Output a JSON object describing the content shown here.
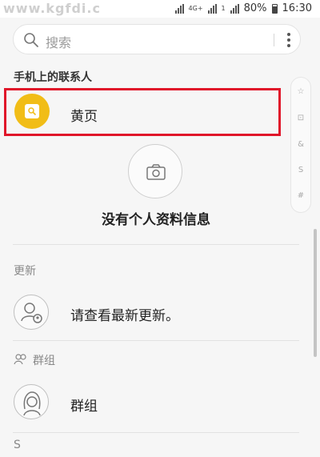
{
  "status_bar": {
    "watermark": "www.kgfdi.c",
    "battery": "80%",
    "time": "16:30",
    "signal_label_1": "4G+",
    "signal_label_2": "1"
  },
  "search": {
    "placeholder": "搜索",
    "icon": "search-icon",
    "menu_icon": "more-vert-icon"
  },
  "sections": {
    "phone_contacts": "手机上的联系人",
    "updates": "更新",
    "groups": "群组",
    "s_header": "S"
  },
  "yellow_pages": {
    "label": "黄页",
    "accent": "#f1bd17"
  },
  "profile": {
    "empty_text": "没有个人资料信息",
    "icon": "camera-icon"
  },
  "updates_row": {
    "label": "请查看最新更新。",
    "icon": "person-update-icon"
  },
  "groups_row": {
    "label": "群组",
    "icon": "group-avatar-icon"
  },
  "index_bar": [
    "☆",
    "⊡",
    "&",
    "S",
    "#"
  ],
  "highlight_color": "#e0162a"
}
